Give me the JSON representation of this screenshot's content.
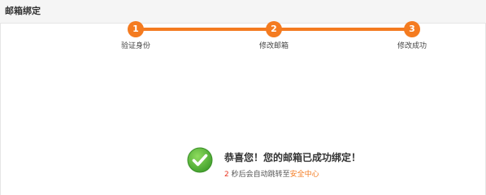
{
  "header": {
    "title": "邮箱绑定"
  },
  "steps": [
    {
      "number": "1",
      "label": "验证身份"
    },
    {
      "number": "2",
      "label": "修改邮箱"
    },
    {
      "number": "3",
      "label": "修改成功"
    }
  ],
  "result": {
    "icon": "check-circle-icon",
    "title": "恭喜您！您的邮箱已成功绑定！",
    "countdown": "2",
    "note": "秒后会自动跳转至",
    "link_label": "安全中心"
  },
  "colors": {
    "accent": "#f47b20",
    "success": "#52b83a",
    "countdown": "#e8321f"
  }
}
